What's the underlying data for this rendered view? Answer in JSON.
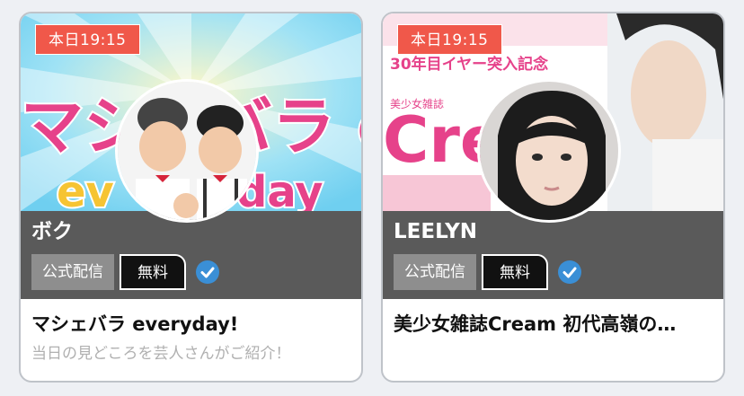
{
  "cards": [
    {
      "time_badge": "本日19:15",
      "banner_text": "マシェバラ everyday",
      "performer": "ボク",
      "tag_official": "公式配信",
      "tag_free": "無料",
      "title": "マシェバラ everyday!",
      "subtitle": "当日の見どころを芸人さんがご紹介！"
    },
    {
      "time_badge": "本日19:15",
      "banner_text_top": "30年目イヤー突入記念",
      "banner_text_mid": "美少女雑誌",
      "banner_text_big": "Crea",
      "performer": "LEELYN",
      "tag_official": "公式配信",
      "tag_free": "無料",
      "title": "美少女雑誌Cream 初代高嶺の…",
      "subtitle": ""
    }
  ],
  "colors": {
    "badge": "#f0584a",
    "band": "#5a5a5a",
    "official_tag": "#8e8e8e",
    "free_tag": "#111111",
    "verified": "#3a8fd6"
  },
  "icons": [
    "verified-check-icon"
  ]
}
